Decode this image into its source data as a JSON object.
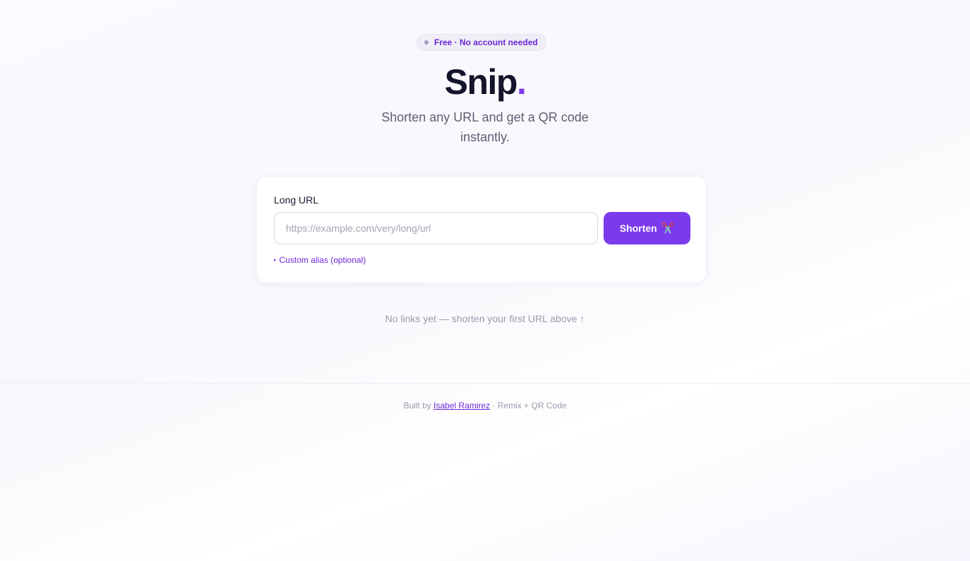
{
  "badge": {
    "text": "Free · No account needed"
  },
  "hero": {
    "logo_text": "Snip",
    "logo_dot": ".",
    "tagline": "Shorten any URL and get a QR code instantly."
  },
  "form": {
    "label": "Long URL",
    "url_value": "",
    "url_placeholder": "https://example.com/very/long/url",
    "shorten_label": "Shorten",
    "shorten_icon": "✂️",
    "alias_icon": "▸",
    "alias_label": "Custom alias (optional)"
  },
  "empty_state": "No links yet — shorten your first URL above ↑",
  "footer": {
    "prefix": "Built by ",
    "author": "Isabel Ramirez",
    "suffix": " · Remix + QR Code"
  },
  "colors": {
    "accent": "#7c3aed",
    "accent_text": "#6d28d9",
    "heading": "#14142b",
    "muted": "#9a9aac"
  }
}
